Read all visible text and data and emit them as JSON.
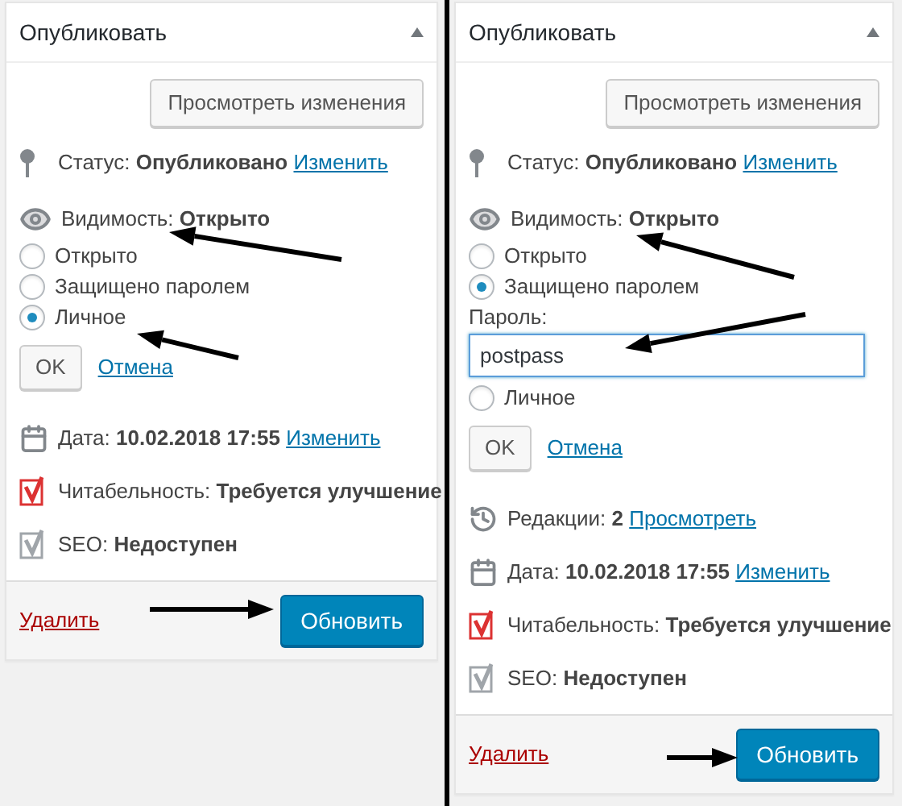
{
  "panels": [
    {
      "title": "Опубликовать",
      "preview_button": "Просмотреть изменения",
      "status": {
        "label": "Статус:",
        "value": "Опубликовано",
        "link": "Изменить"
      },
      "visibility": {
        "label": "Видимость:",
        "value": "Открыто"
      },
      "options": [
        {
          "kind": "radio",
          "label": "Открыто",
          "selected": false
        },
        {
          "kind": "radio",
          "label": "Защищено паролем",
          "selected": false
        },
        {
          "kind": "radio",
          "label": "Личное",
          "selected": true
        }
      ],
      "ok_button": "OK",
      "cancel_link": "Отмена",
      "info": [
        {
          "kind": "date",
          "label": "Дата:",
          "value": "10.02.2018 17:55",
          "link": "Изменить"
        },
        {
          "kind": "readability",
          "label": "Читабельность:",
          "value": "Требуется улучшение"
        },
        {
          "kind": "seo",
          "label": "SEO:",
          "value": "Недоступен"
        }
      ],
      "delete_link": "Удалить",
      "update_button": "Обновить"
    },
    {
      "title": "Опубликовать",
      "preview_button": "Просмотреть изменения",
      "status": {
        "label": "Статус:",
        "value": "Опубликовано",
        "link": "Изменить"
      },
      "visibility": {
        "label": "Видимость:",
        "value": "Открыто"
      },
      "options": [
        {
          "kind": "radio",
          "label": "Открыто",
          "selected": false
        },
        {
          "kind": "radio",
          "label": "Защищено паролем",
          "selected": true
        },
        {
          "kind": "password",
          "label": "Пароль:",
          "value": "postpass"
        },
        {
          "kind": "radio",
          "label": "Личное",
          "selected": false
        }
      ],
      "ok_button": "OK",
      "cancel_link": "Отмена",
      "info": [
        {
          "kind": "revisions",
          "label": "Редакции:",
          "value": "2",
          "link": "Просмотреть"
        },
        {
          "kind": "date",
          "label": "Дата:",
          "value": "10.02.2018 17:55",
          "link": "Изменить"
        },
        {
          "kind": "readability",
          "label": "Читабельность:",
          "value": "Требуется улучшение"
        },
        {
          "kind": "seo",
          "label": "SEO:",
          "value": "Недоступен"
        }
      ],
      "delete_link": "Удалить",
      "update_button": "Обновить"
    }
  ]
}
